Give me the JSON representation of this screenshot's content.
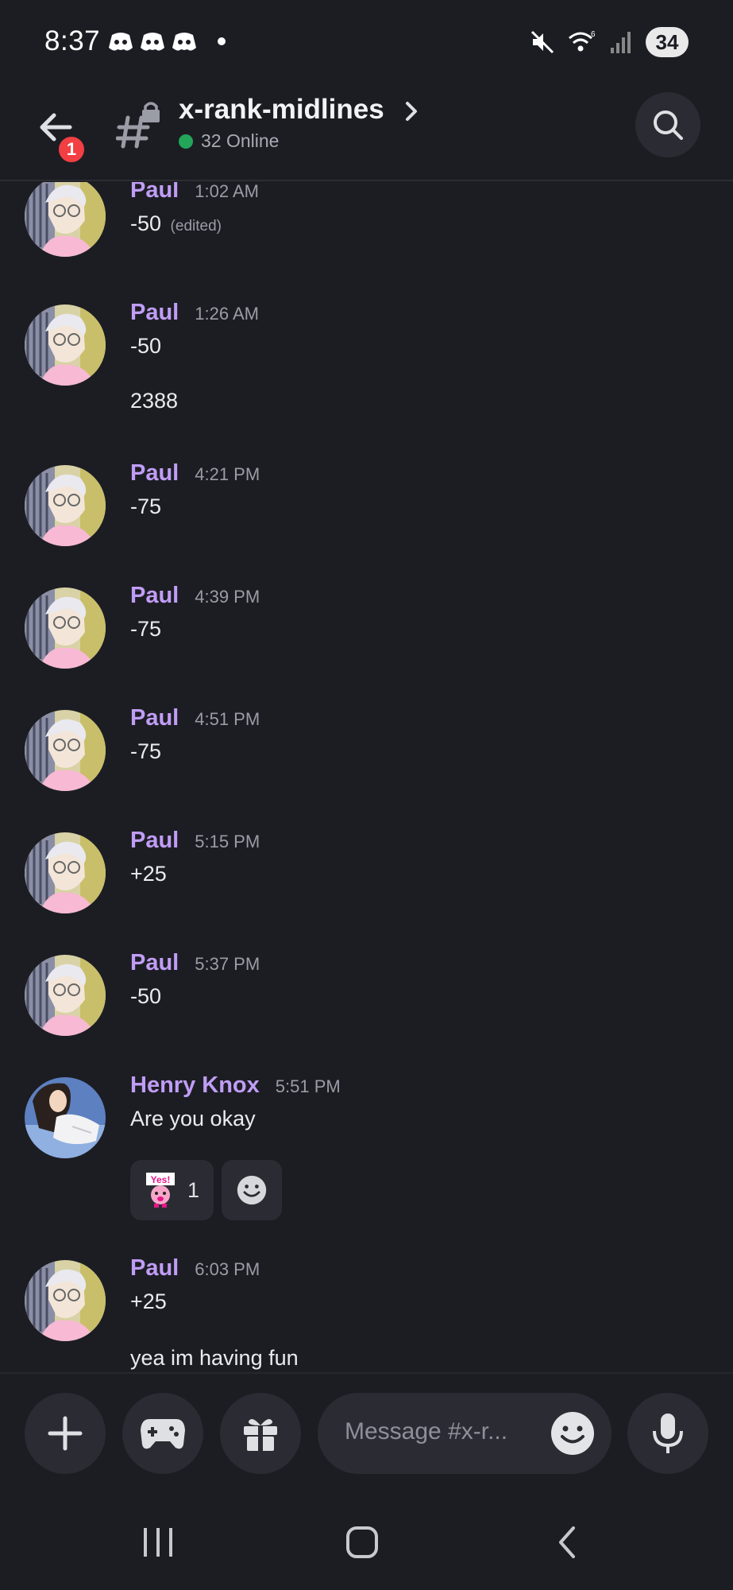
{
  "status_bar": {
    "time": "8:37",
    "battery": "34",
    "icons": [
      "discord-icon",
      "discord-icon",
      "discord-icon",
      "dot",
      "mute-icon",
      "wifi-icon",
      "signal-icon",
      "battery-icon"
    ]
  },
  "header": {
    "notification_badge": "1",
    "channel_name": "x-rank-midlines",
    "online_text": "32 Online"
  },
  "messages": [
    {
      "author": "Paul",
      "time": "1:02 AM",
      "lines": [
        "-50"
      ],
      "edited": "(edited)"
    },
    {
      "author": "Paul",
      "time": "1:26 AM",
      "lines": [
        "-50",
        "2388"
      ]
    },
    {
      "author": "Paul",
      "time": "4:21 PM",
      "lines": [
        "-75"
      ]
    },
    {
      "author": "Paul",
      "time": "4:39 PM",
      "lines": [
        "-75"
      ]
    },
    {
      "author": "Paul",
      "time": "4:51 PM",
      "lines": [
        "-75"
      ]
    },
    {
      "author": "Paul",
      "time": "5:15 PM",
      "lines": [
        "+25"
      ]
    },
    {
      "author": "Paul",
      "time": "5:37 PM",
      "lines": [
        "-50"
      ]
    },
    {
      "author": "Henry Knox",
      "time": "5:51 PM",
      "lines": [
        "Are you okay"
      ],
      "reaction_count": "1",
      "reaction_emoji_text": "Yes!"
    },
    {
      "author": "Paul",
      "time": "6:03 PM",
      "lines": [
        "+25",
        "yea im having fun"
      ]
    }
  ],
  "composer": {
    "placeholder": "Message #x-r..."
  },
  "colors": {
    "background": "#1c1d23",
    "username": "#c09df5",
    "online": "#23a55a",
    "badge": "#f23f43"
  }
}
